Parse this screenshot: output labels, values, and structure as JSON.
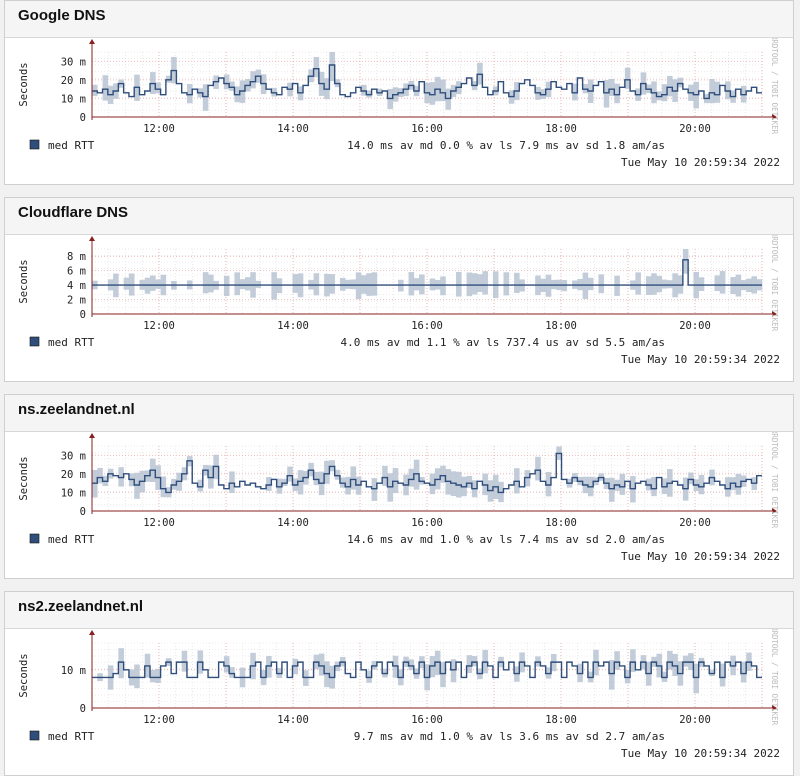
{
  "panels": [
    {
      "title": "Google DNS",
      "chart_data": {
        "type": "line",
        "ylabel": "Seconds",
        "y_ticks": [
          "0",
          "10 m",
          "20 m",
          "30 m"
        ],
        "ylim": [
          0,
          35
        ],
        "xlim": [
          11.0,
          21.0
        ],
        "x_ticks": [
          {
            "v": 12,
            "label": "12:00"
          },
          {
            "v": 14,
            "label": "14:00"
          },
          {
            "v": 16,
            "label": "16:00"
          },
          {
            "v": 18,
            "label": "18:00"
          },
          {
            "v": 20,
            "label": "20:00"
          }
        ],
        "series": [
          {
            "name": "med RTT",
            "values": [
              14,
              13,
              15,
              12,
              14,
              18,
              13,
              11,
              16,
              12,
              14,
              18,
              15,
              12,
              20,
              25,
              18,
              13,
              12,
              15,
              13,
              11,
              17,
              19,
              21,
              18,
              16,
              12,
              14,
              17,
              19,
              22,
              18,
              15,
              13,
              12,
              16,
              15,
              18,
              13,
              17,
              22,
              26,
              18,
              15,
              28,
              18,
              12,
              11,
              13,
              16,
              14,
              12,
              15,
              13,
              14,
              10,
              12,
              13,
              15,
              17,
              14,
              19,
              13,
              12,
              15,
              13,
              10,
              14,
              16,
              18,
              21,
              17,
              23,
              16,
              12,
              14,
              19,
              13,
              11,
              14,
              18,
              20,
              17,
              13,
              12,
              15,
              19,
              16,
              15,
              18,
              13,
              21,
              15,
              14,
              17,
              19,
              13,
              15,
              12,
              16,
              20,
              14,
              12,
              18,
              15,
              13,
              11,
              12,
              16,
              14,
              18,
              15,
              13,
              12,
              14,
              10,
              13,
              12,
              17,
              14,
              11,
              15,
              12,
              14,
              16,
              13
            ]
          }
        ],
        "legend": [
          {
            "name": "med RTT",
            "text": "14.0 ms av md      0.0 % av ls     7.9 ms av sd     1.8   am/as"
          }
        ],
        "timestamp": "Tue May 10 20:59:34 2022",
        "side_label": "RRDTOOL / TOBI OETIKER"
      }
    },
    {
      "title": "Cloudflare DNS",
      "chart_data": {
        "type": "line",
        "ylabel": "Seconds",
        "y_ticks": [
          "0",
          "2 m",
          "4 m",
          "6 m",
          "8 m"
        ],
        "ylim": [
          0,
          9
        ],
        "xlim": [
          11.0,
          21.0
        ],
        "x_ticks": [
          {
            "v": 12,
            "label": "12:00"
          },
          {
            "v": 14,
            "label": "14:00"
          },
          {
            "v": 16,
            "label": "16:00"
          },
          {
            "v": 18,
            "label": "18:00"
          },
          {
            "v": 20,
            "label": "20:00"
          }
        ],
        "series": [
          {
            "name": "med RTT",
            "values": [
              4,
              4,
              4,
              4,
              4,
              4,
              4,
              4,
              4,
              4,
              4,
              4,
              4,
              4,
              4,
              4,
              4,
              4,
              4,
              4,
              4,
              4,
              4,
              4,
              4,
              4,
              4,
              4,
              4,
              4,
              4,
              4,
              4,
              4,
              4,
              4,
              4,
              4,
              4,
              4,
              4,
              4,
              4,
              4,
              4,
              4,
              4,
              4,
              4,
              4,
              4,
              4,
              4,
              4,
              4,
              4,
              4,
              4,
              4,
              4,
              4,
              4,
              4,
              4,
              4,
              4,
              4,
              4,
              4,
              4,
              4,
              4,
              4,
              4,
              4,
              4,
              4,
              4,
              4,
              4,
              4,
              4,
              4,
              4,
              4,
              4,
              4,
              4,
              4,
              4,
              4,
              4,
              4,
              4,
              4,
              4,
              4,
              4,
              4,
              4,
              4,
              4,
              4,
              4,
              4,
              4,
              4,
              4,
              4,
              4,
              4,
              4,
              7.5,
              4,
              4,
              4,
              4,
              4,
              4,
              4,
              4,
              4,
              4,
              4,
              4,
              4,
              4
            ]
          }
        ],
        "legend": [
          {
            "name": "med RTT",
            "text": "4.0 ms av md      1.1 % av ls   737.4 us av sd     5.5   am/as"
          }
        ],
        "timestamp": "Tue May 10 20:59:34 2022",
        "side_label": "RRDTOOL / TOBI OETIKER"
      }
    },
    {
      "title": "ns.zeelandnet.nl",
      "chart_data": {
        "type": "line",
        "ylabel": "Seconds",
        "y_ticks": [
          "0",
          "10 m",
          "20 m",
          "30 m"
        ],
        "ylim": [
          0,
          35
        ],
        "xlim": [
          11.0,
          21.0
        ],
        "x_ticks": [
          {
            "v": 12,
            "label": "12:00"
          },
          {
            "v": 14,
            "label": "14:00"
          },
          {
            "v": 16,
            "label": "16:00"
          },
          {
            "v": 18,
            "label": "18:00"
          },
          {
            "v": 20,
            "label": "20:00"
          }
        ],
        "series": [
          {
            "name": "med RTT",
            "values": [
              15,
              18,
              16,
              20,
              19,
              18,
              20,
              17,
              14,
              16,
              19,
              22,
              18,
              12,
              10,
              14,
              16,
              20,
              27,
              15,
              13,
              22,
              18,
              24,
              14,
              12,
              15,
              13,
              16,
              14,
              15,
              13,
              12,
              14,
              17,
              13,
              15,
              19,
              14,
              16,
              18,
              22,
              17,
              15,
              20,
              24,
              19,
              15,
              13,
              17,
              14,
              16,
              13,
              12,
              15,
              18,
              13,
              16,
              15,
              14,
              17,
              20,
              16,
              15,
              14,
              17,
              19,
              16,
              15,
              14,
              13,
              15,
              12,
              16,
              14,
              11,
              13,
              10,
              12,
              14,
              16,
              13,
              18,
              20,
              22,
              16,
              14,
              18,
              31,
              17,
              15,
              18,
              16,
              14,
              13,
              16,
              18,
              15,
              12,
              14,
              13,
              16,
              12,
              15,
              16,
              14,
              12,
              18,
              13,
              15,
              16,
              14,
              12,
              17,
              14,
              13,
              15,
              18,
              16,
              14,
              12,
              15,
              13,
              16,
              17,
              15,
              19
            ]
          }
        ],
        "legend": [
          {
            "name": "med RTT",
            "text": "14.6 ms av md      1.0 % av ls     7.4 ms av sd     2.0   am/as"
          }
        ],
        "timestamp": "Tue May 10 20:59:34 2022",
        "side_label": "RRDTOOL / TOBI OETIKER"
      }
    },
    {
      "title": "ns2.zeelandnet.nl",
      "chart_data": {
        "type": "line",
        "ylabel": "Seconds",
        "y_ticks": [
          "0",
          "10 m"
        ],
        "ylim": [
          0,
          17
        ],
        "xlim": [
          11.0,
          21.0
        ],
        "x_ticks": [
          {
            "v": 12,
            "label": "12:00"
          },
          {
            "v": 14,
            "label": "14:00"
          },
          {
            "v": 16,
            "label": "16:00"
          },
          {
            "v": 18,
            "label": "18:00"
          },
          {
            "v": 20,
            "label": "20:00"
          }
        ],
        "series": [
          {
            "name": "med RTT",
            "values": [
              8,
              8,
              8,
              8,
              9,
              12,
              10,
              8,
              8,
              8,
              11,
              8,
              8,
              11,
              12,
              9,
              12,
              12,
              8,
              8,
              12,
              10,
              8,
              8,
              12,
              11,
              9,
              8,
              8,
              8,
              11,
              12,
              8,
              11,
              12,
              9,
              12,
              8,
              11,
              12,
              8,
              8,
              12,
              11,
              9,
              8,
              11,
              12,
              9,
              8,
              12,
              10,
              8,
              11,
              12,
              9,
              12,
              11,
              8,
              12,
              11,
              9,
              12,
              8,
              11,
              12,
              9,
              12,
              10,
              12,
              8,
              11,
              12,
              9,
              12,
              11,
              8,
              12,
              10,
              12,
              9,
              12,
              11,
              8,
              12,
              11,
              9,
              12,
              12,
              8,
              12,
              11,
              9,
              12,
              8,
              12,
              11,
              12,
              9,
              12,
              11,
              8,
              12,
              10,
              12,
              9,
              12,
              11,
              8,
              12,
              11,
              9,
              12,
              12,
              8,
              12,
              11,
              9,
              12,
              8,
              12,
              11,
              12,
              9,
              12,
              11,
              8
            ]
          }
        ],
        "legend": [
          {
            "name": "med RTT",
            "text": "9.7 ms av md      1.0 % av ls     3.6 ms av sd     2.7   am/as"
          }
        ],
        "timestamp": "Tue May 10 20:59:34 2022",
        "side_label": "RRDTOOL / TOBI OETIKER"
      }
    }
  ],
  "colors": {
    "line": "#2f4e7b",
    "band": "#b8c4d4",
    "grid_minor": "#d9d9d9",
    "grid_major": "#e9a3a3",
    "axis": "#8a1f1f",
    "legend_swatch": "#2f4e7b"
  }
}
